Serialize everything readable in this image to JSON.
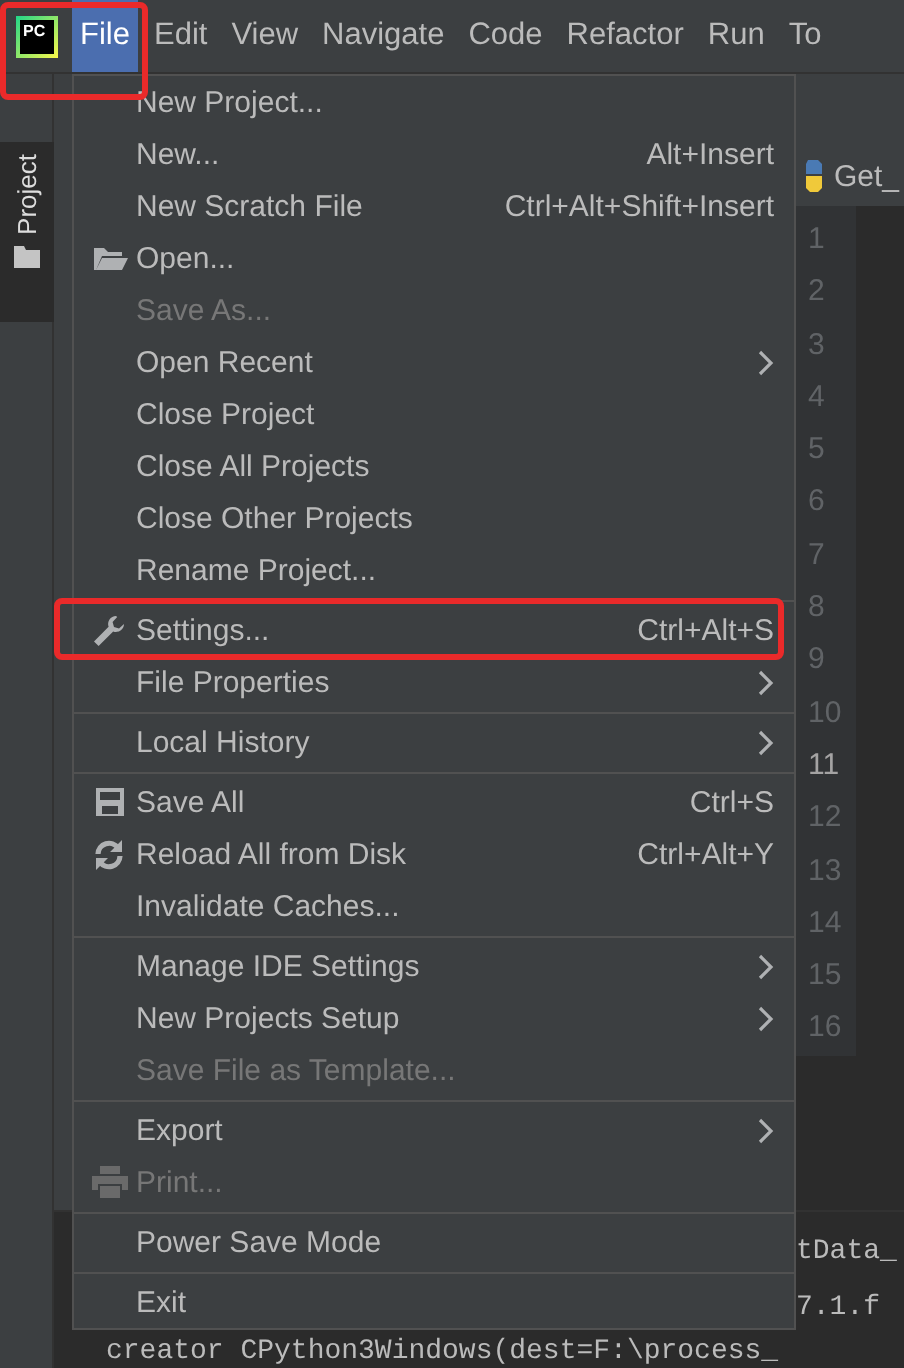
{
  "logo": {
    "text": "PC"
  },
  "menu_bar": [
    {
      "label": "File",
      "selected": true
    },
    {
      "label": "Edit",
      "selected": false
    },
    {
      "label": "View",
      "selected": false
    },
    {
      "label": "Navigate",
      "selected": false
    },
    {
      "label": "Code",
      "selected": false
    },
    {
      "label": "Refactor",
      "selected": false
    },
    {
      "label": "Run",
      "selected": false
    },
    {
      "label": "To",
      "selected": false
    }
  ],
  "side_tab": {
    "label": "Project",
    "selected": true
  },
  "editor": {
    "tab": "Get_",
    "line_numbers": [
      {
        "text": "1",
        "current": false
      },
      {
        "text": "2",
        "current": false
      },
      {
        "text": "3",
        "current": false
      },
      {
        "text": "4",
        "current": false
      },
      {
        "text": "5",
        "current": false
      },
      {
        "text": "6",
        "current": false
      },
      {
        "text": "7",
        "current": false
      },
      {
        "text": "8",
        "current": false
      },
      {
        "text": "9",
        "current": false
      },
      {
        "text": "10",
        "current": false
      },
      {
        "text": "11",
        "current": true
      },
      {
        "text": "12",
        "current": false
      },
      {
        "text": "13",
        "current": false
      },
      {
        "text": "14",
        "current": false
      },
      {
        "text": "15",
        "current": false
      },
      {
        "text": "16",
        "current": false
      }
    ]
  },
  "console": {
    "lines": [
      {
        "kind": "tail",
        "text": "tData_"
      },
      {
        "kind": "tail",
        "text": "7.1.f"
      },
      {
        "kind": "full",
        "text": "creator CPython3Windows(dest=F:\\process_"
      }
    ]
  },
  "file_menu": {
    "sections": [
      [
        {
          "label": "New Project...",
          "kind": "plain",
          "disabled": false,
          "submenu": false
        },
        {
          "label": "New...",
          "shortcut": "Alt+Insert",
          "kind": "plain",
          "disabled": false,
          "submenu": false
        },
        {
          "label": "New Scratch File",
          "shortcut": "Ctrl+Alt+Shift+Insert",
          "kind": "plain",
          "disabled": false,
          "submenu": false
        },
        {
          "label": "Open...",
          "kind": "folder",
          "disabled": false,
          "submenu": false
        },
        {
          "label": "Save As...",
          "kind": "plain",
          "disabled": true,
          "submenu": false
        },
        {
          "label": "Open Recent",
          "kind": "plain",
          "disabled": false,
          "submenu": true
        },
        {
          "label": "Close Project",
          "kind": "plain",
          "disabled": false,
          "submenu": false
        },
        {
          "label": "Close All Projects",
          "kind": "plain",
          "disabled": false,
          "submenu": false
        },
        {
          "label": "Close Other Projects",
          "kind": "plain",
          "disabled": false,
          "submenu": false
        },
        {
          "label": "Rename Project...",
          "kind": "plain",
          "disabled": false,
          "submenu": false
        }
      ],
      [
        {
          "label": "Settings...",
          "shortcut": "Ctrl+Alt+S",
          "kind": "wrench",
          "disabled": false,
          "submenu": false,
          "highlighted": true
        },
        {
          "label": "File Properties",
          "kind": "plain",
          "disabled": false,
          "submenu": true
        }
      ],
      [
        {
          "label": "Local History",
          "kind": "plain",
          "disabled": false,
          "submenu": true
        }
      ],
      [
        {
          "label": "Save All",
          "shortcut": "Ctrl+S",
          "kind": "save",
          "disabled": false,
          "submenu": false
        },
        {
          "label": "Reload All from Disk",
          "shortcut": "Ctrl+Alt+Y",
          "kind": "reload",
          "disabled": false,
          "submenu": false
        },
        {
          "label": "Invalidate Caches...",
          "kind": "plain",
          "disabled": false,
          "submenu": false
        }
      ],
      [
        {
          "label": "Manage IDE Settings",
          "kind": "plain",
          "disabled": false,
          "submenu": true
        },
        {
          "label": "New Projects Setup",
          "kind": "plain",
          "disabled": false,
          "submenu": true
        },
        {
          "label": "Save File as Template...",
          "kind": "plain",
          "disabled": true,
          "submenu": false
        }
      ],
      [
        {
          "label": "Export",
          "kind": "plain",
          "disabled": false,
          "submenu": true
        },
        {
          "label": "Print...",
          "kind": "printer",
          "disabled": true,
          "submenu": false
        }
      ],
      [
        {
          "label": "Power Save Mode",
          "kind": "plain",
          "disabled": false,
          "submenu": false
        }
      ],
      [
        {
          "label": "Exit",
          "kind": "plain",
          "disabled": false,
          "submenu": false
        }
      ]
    ]
  }
}
